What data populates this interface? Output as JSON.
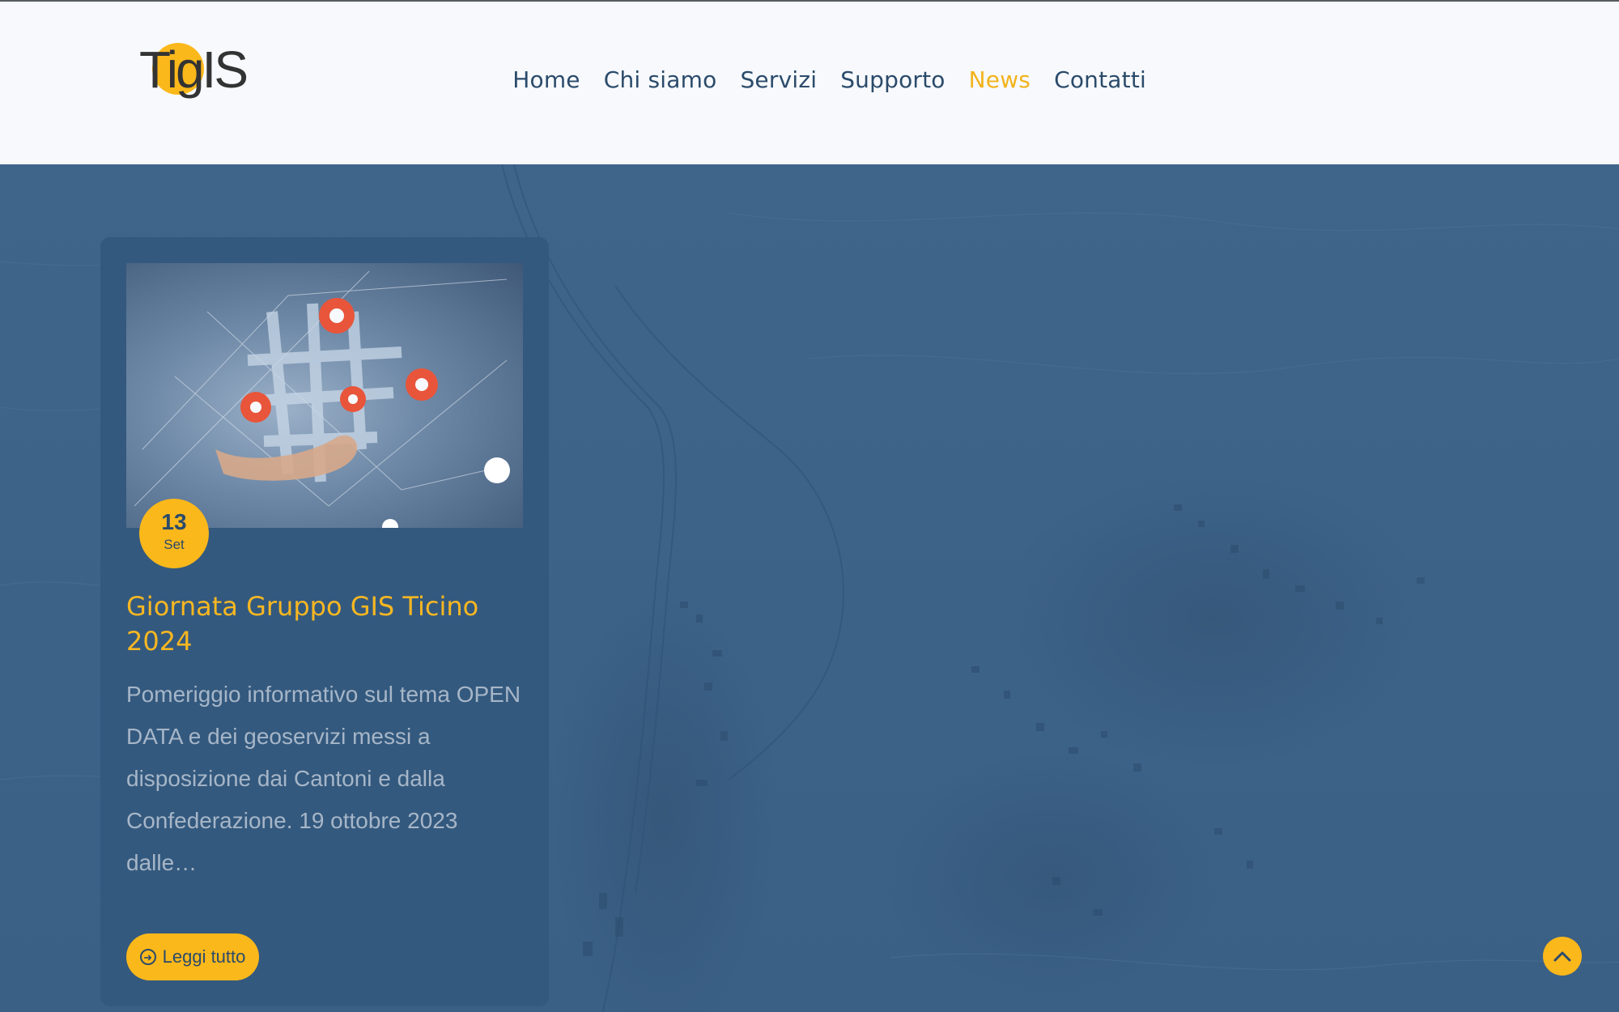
{
  "header": {
    "logo_text": "TigIS",
    "nav": [
      {
        "label": "Home"
      },
      {
        "label": "Chi siamo"
      },
      {
        "label": "Servizi"
      },
      {
        "label": "Supporto"
      },
      {
        "label": "News"
      },
      {
        "label": "Contatti"
      }
    ],
    "active_nav": "News"
  },
  "news_card": {
    "date_day": "13",
    "date_month": "Set",
    "title": "Giornata Gruppo GIS Ticino 2024",
    "excerpt": "Pomeriggio informativo sul tema OPEN DATA e dei geoservizi messi a disposizione dai Cantoni e dalla Confederazione. 19 ottobre 2023  dalle…",
    "read_more_label": "Leggi tutto",
    "read_more_icon": "arrow-circle-right-icon",
    "image_icon": "map-pins-network-image"
  },
  "back_to_top_icon": "chevron-up-icon",
  "colors": {
    "accent": "#fbb81b",
    "nav_text": "#2b4b6b",
    "hero_overlay": "#3d6389",
    "card_bg": "#34597e"
  }
}
